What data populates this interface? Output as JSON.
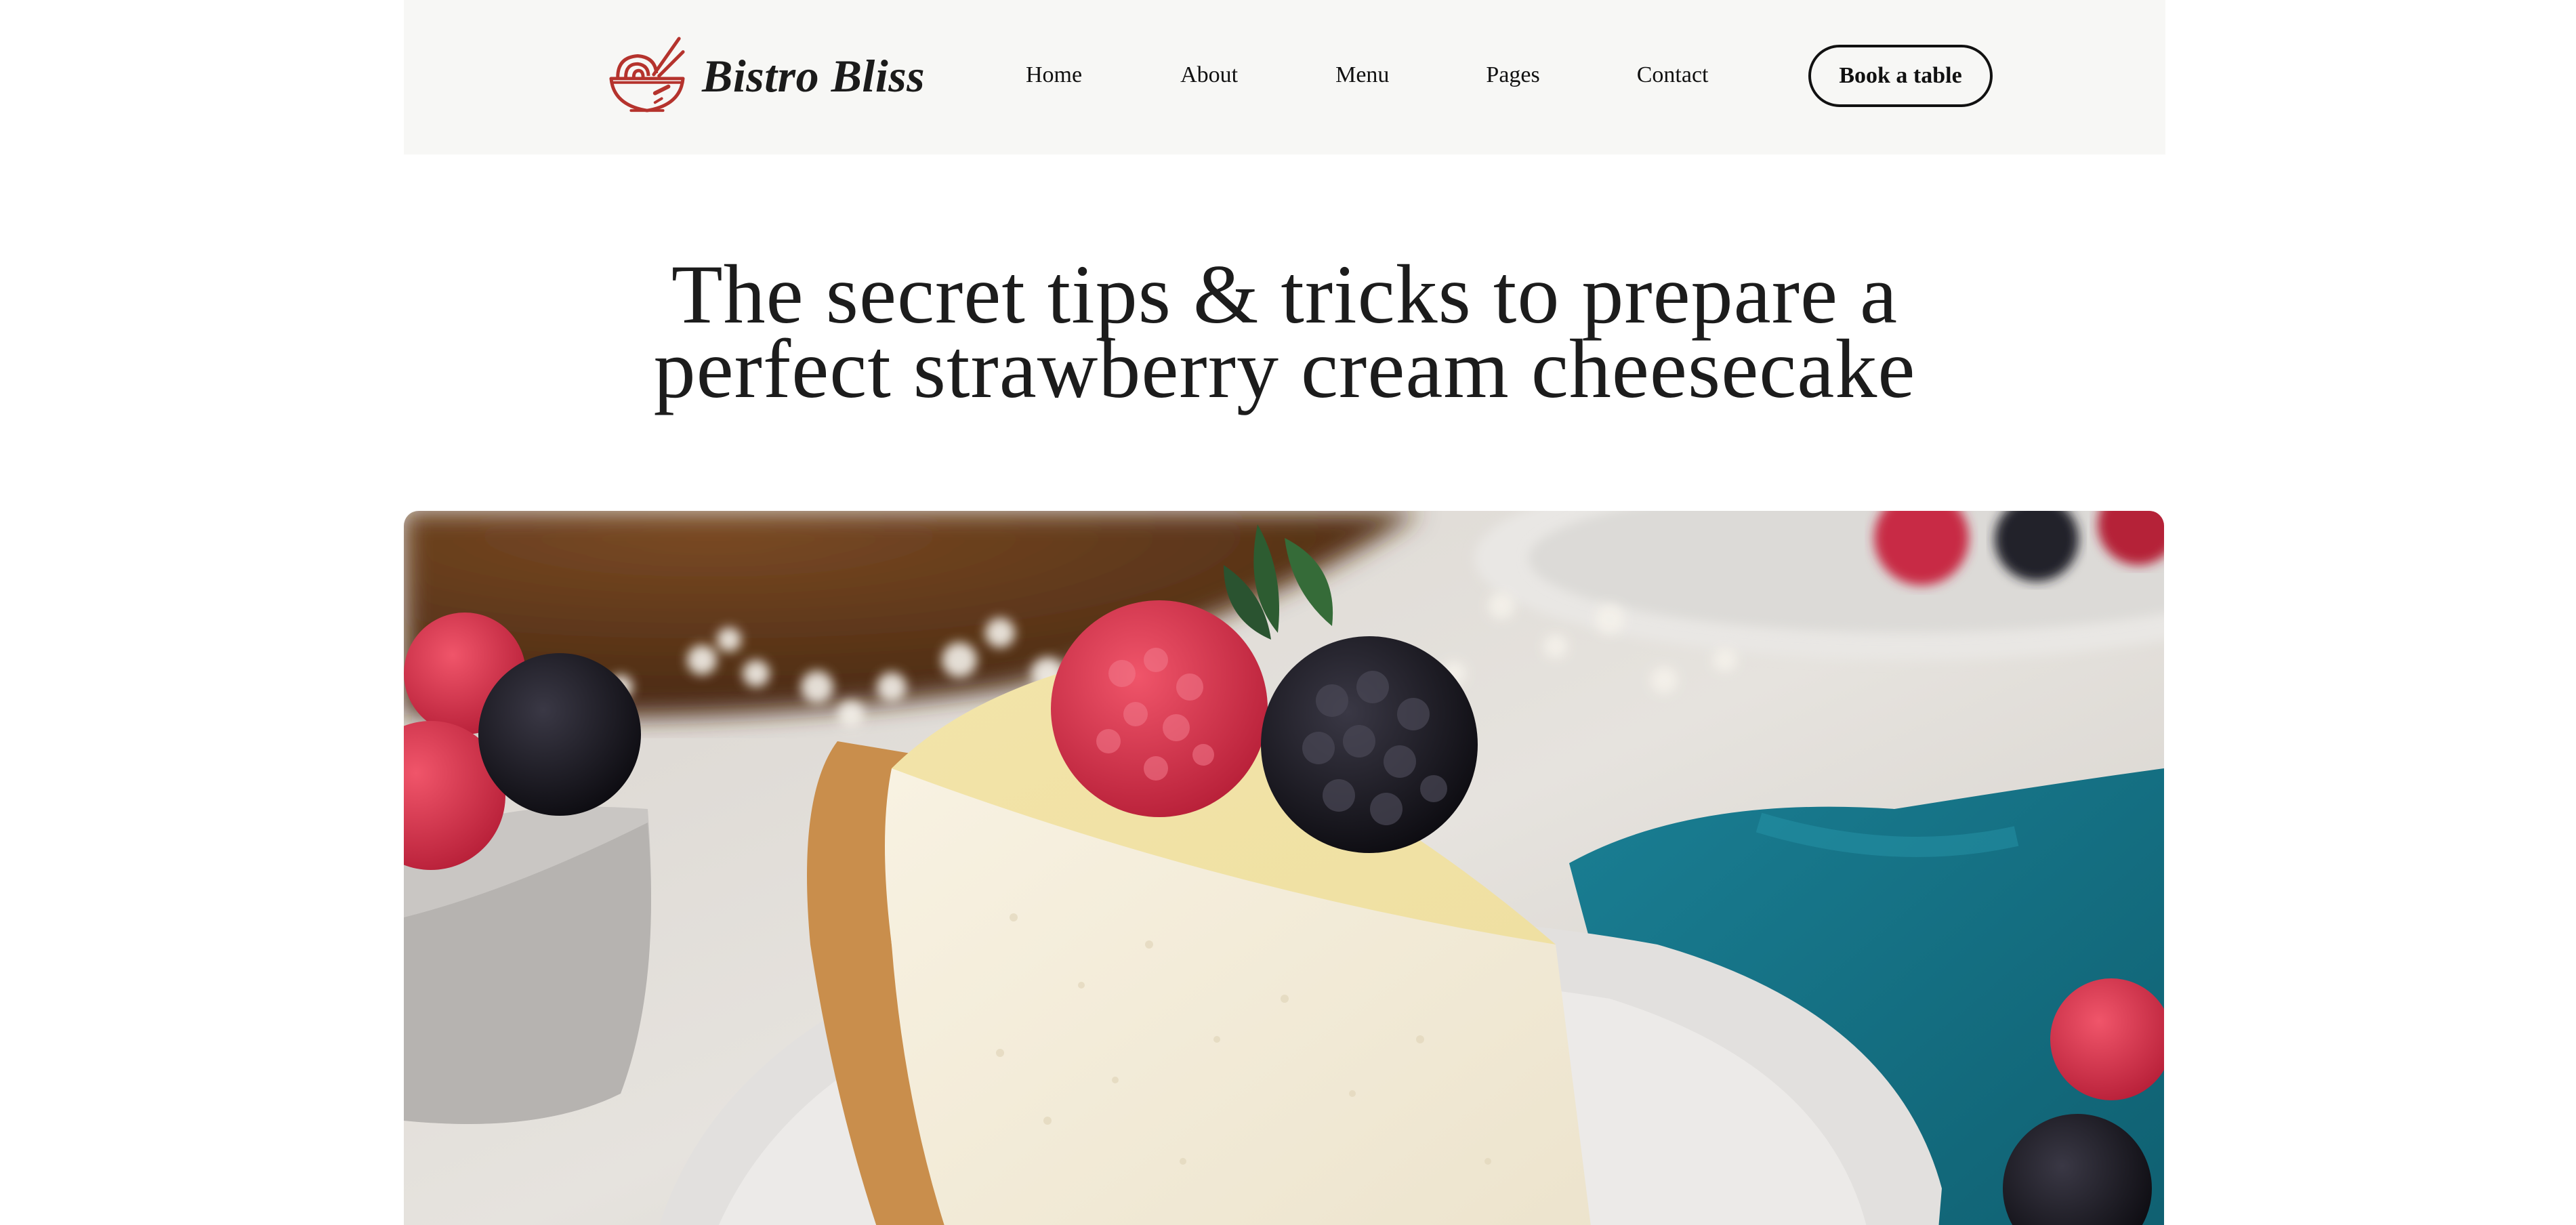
{
  "header": {
    "brand_name": "Bistro Bliss",
    "logo_icon": "noodle-bowl-icon",
    "nav": [
      {
        "label": "Home"
      },
      {
        "label": "About"
      },
      {
        "label": "Menu"
      },
      {
        "label": "Pages"
      },
      {
        "label": "Contact"
      }
    ],
    "cta_label": "Book a table"
  },
  "article": {
    "title_line1": "The secret tips & tricks to prepare a",
    "title_line2": "perfect strawberry cream cheesecake",
    "hero_image": "strawberry-cheesecake-photo"
  },
  "colors": {
    "header_bg": "#f7f7f5",
    "logo_red": "#b5332d",
    "text_dark": "#1c1c1c"
  }
}
